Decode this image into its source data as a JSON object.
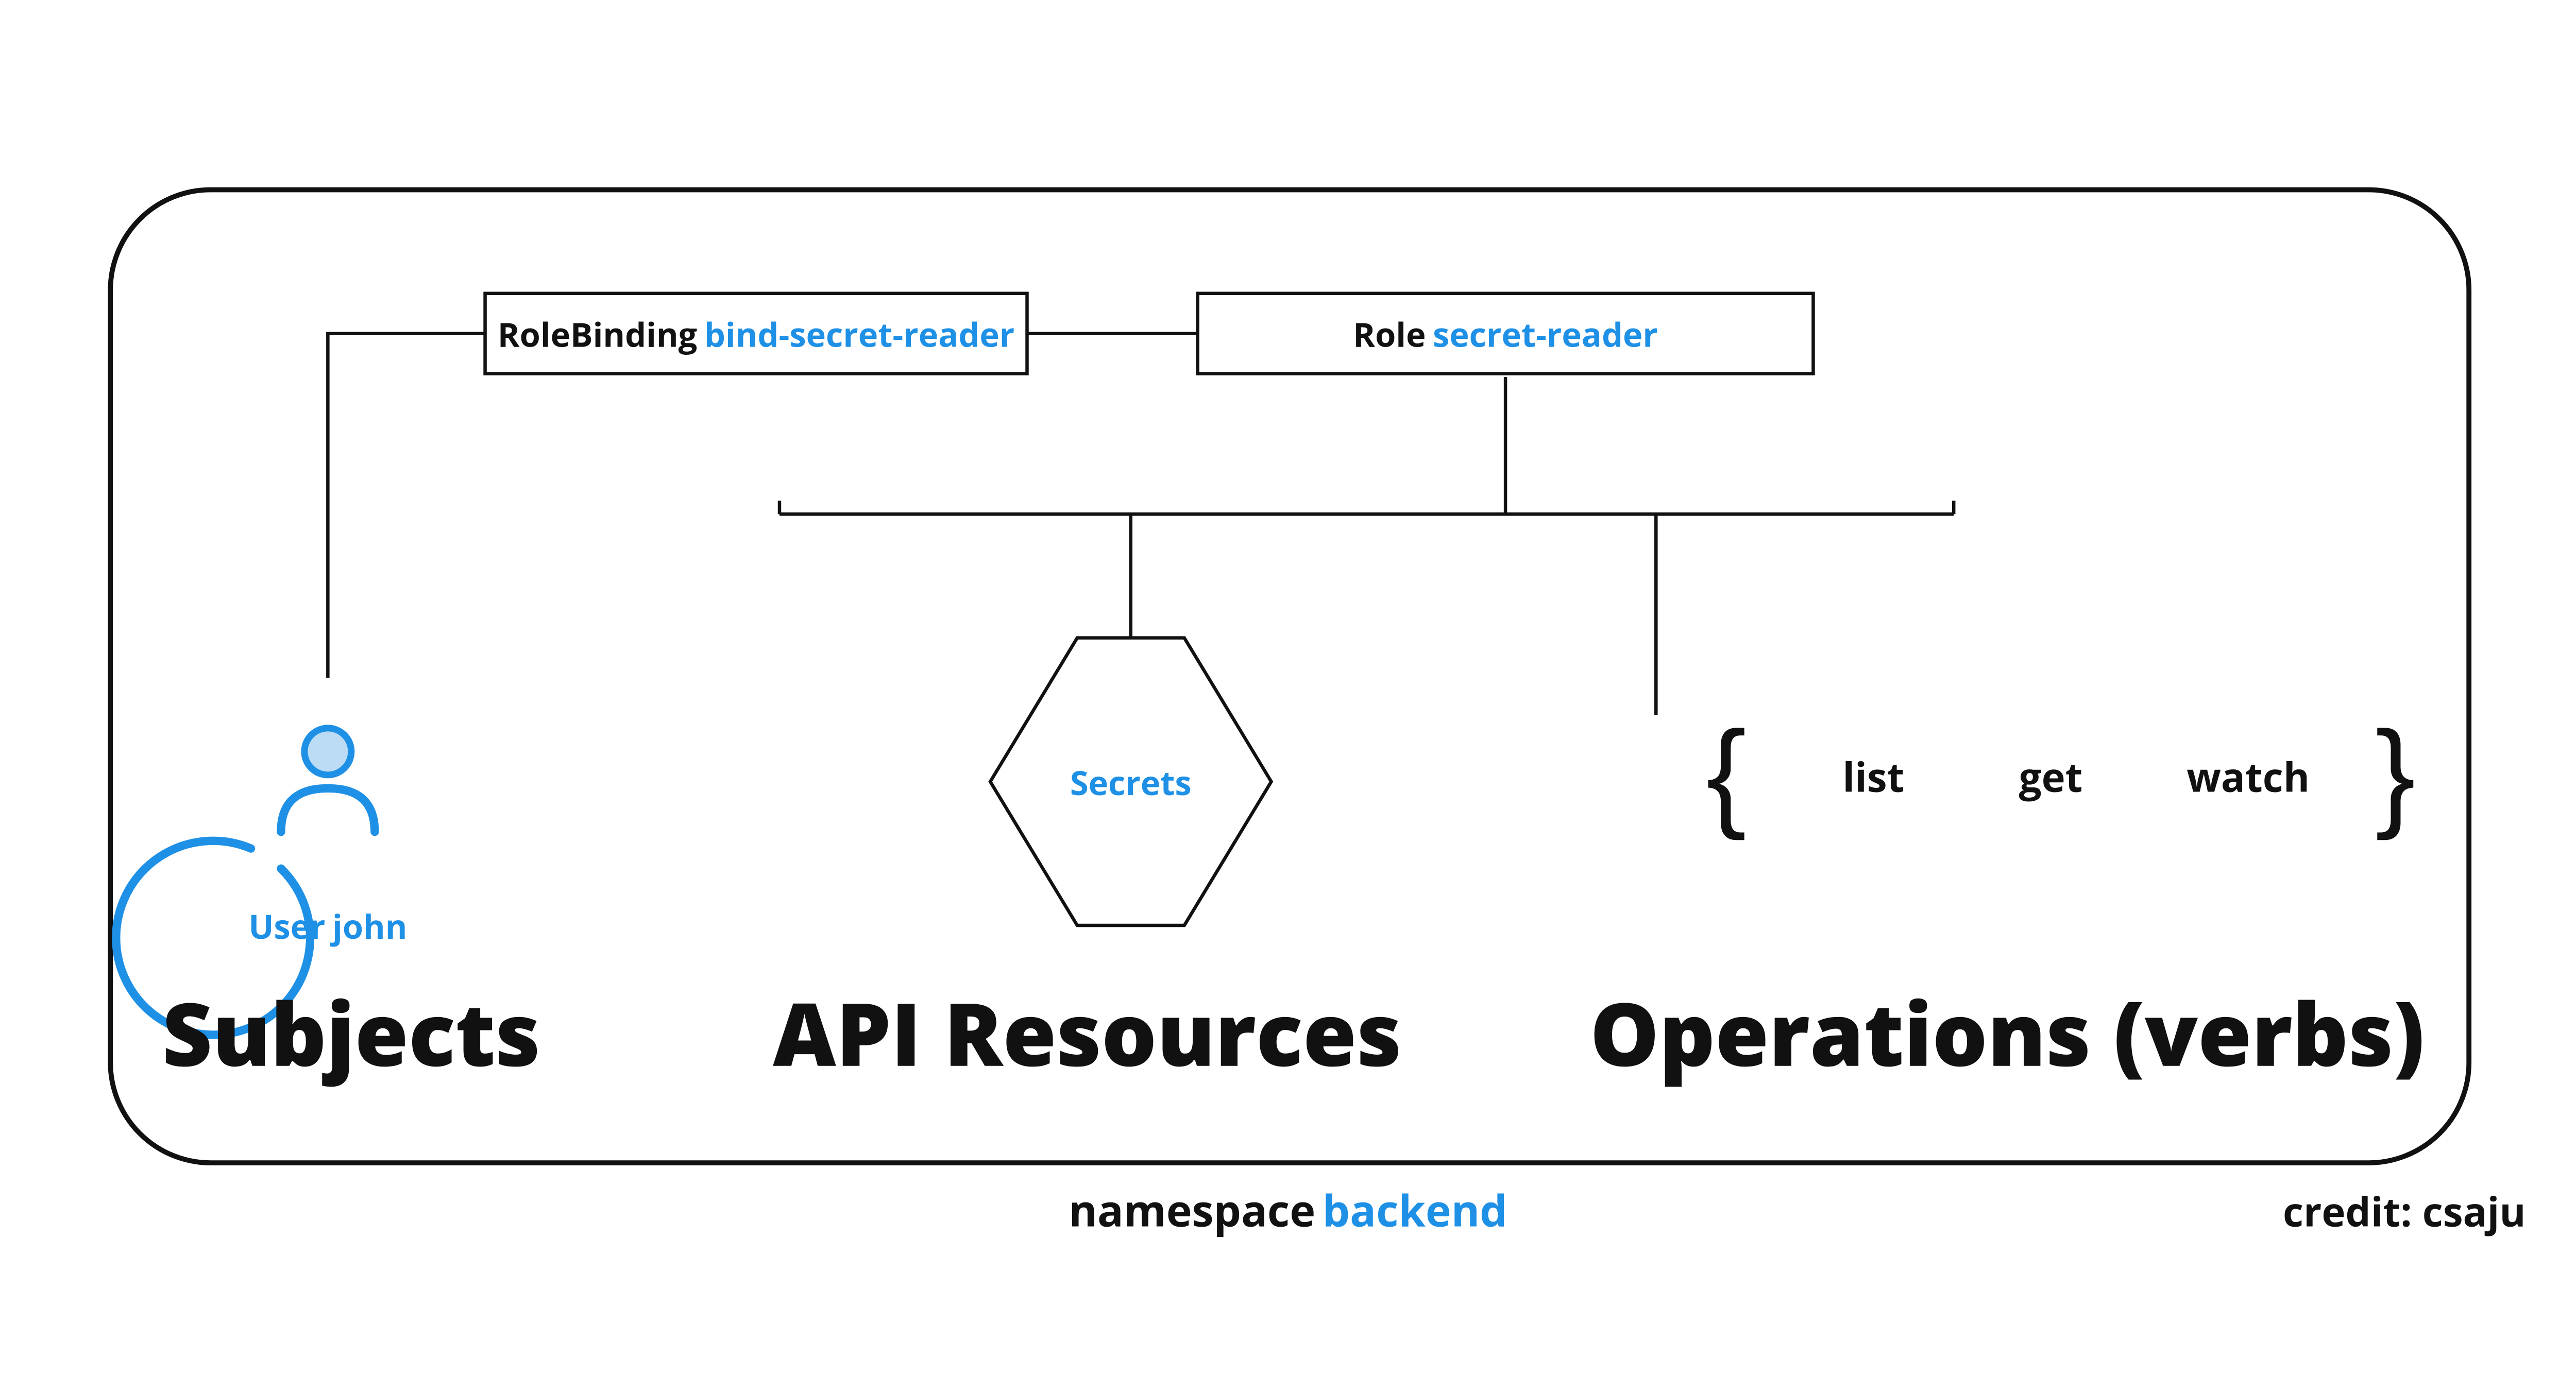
{
  "rolebinding": {
    "kind": "RoleBinding",
    "name": "bind-secret-reader"
  },
  "role": {
    "kind": "Role",
    "name": "secret-reader"
  },
  "resources": {
    "label": "Secrets"
  },
  "verbs": [
    "list",
    "get",
    "watch"
  ],
  "subject": {
    "kind": "User",
    "name": "john"
  },
  "sections": {
    "subjects": "Subjects",
    "resources": "API Resources",
    "operations": "Operations (verbs)"
  },
  "namespace": {
    "label": "namespace",
    "name": "backend"
  },
  "credit": "credit: csaju"
}
